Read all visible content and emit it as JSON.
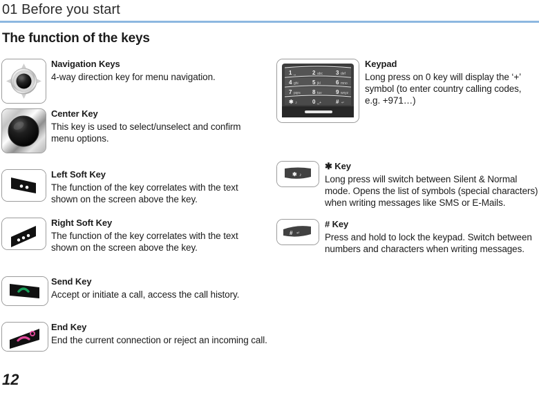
{
  "header": {
    "chapter": "01 Before you start",
    "section": "The function of the keys",
    "rule_color": "#8cb7e0"
  },
  "page_number": "12",
  "left_column": [
    {
      "icon": "navigation-keys-icon",
      "title": "Navigation Keys",
      "desc": "4-way direction key for menu navigation."
    },
    {
      "icon": "center-key-icon",
      "title": "Center Key",
      "desc": "This key is used to select/unselect and confirm menu options."
    },
    {
      "icon": "left-soft-key-icon",
      "title": "Left Soft Key",
      "desc": "The function of the key correlates with the text shown on the screen above the key."
    },
    {
      "icon": "right-soft-key-icon",
      "title": "Right Soft Key",
      "desc": "The function of the key correlates with the text shown on the screen above the key."
    },
    {
      "icon": "send-key-icon",
      "title": "Send Key",
      "desc": "Accept or initiate a call, access the call history."
    },
    {
      "icon": "end-key-icon",
      "title": "End Key",
      "desc": "End the current connection or reject an incoming call."
    }
  ],
  "right_column": [
    {
      "icon": "keypad-icon",
      "title": "Keypad",
      "desc": "Long press on 0 key will display the ‘+’ symbol (to enter country calling codes, e.g. +971…)"
    },
    {
      "icon": "star-key-icon",
      "title": "✱ Key",
      "desc": "Long press will switch between Silent & Normal mode. Opens the list of symbols (special characters) when writing messages like SMS or E-Mails."
    },
    {
      "icon": "hash-key-icon",
      "title": "# Key",
      "desc": "Press and hold to lock the keypad. Switch between numbers and characters when writing messages."
    }
  ],
  "keypad_icon": {
    "rows": [
      [
        {
          "num": "1",
          "sub": "␣"
        },
        {
          "num": "2",
          "sub": "abc"
        },
        {
          "num": "3",
          "sub": "def"
        }
      ],
      [
        {
          "num": "4",
          "sub": "ghi"
        },
        {
          "num": "5",
          "sub": "jkl"
        },
        {
          "num": "6",
          "sub": "mno"
        }
      ],
      [
        {
          "num": "7",
          "sub": "pqrs"
        },
        {
          "num": "8",
          "sub": "tuv"
        },
        {
          "num": "9",
          "sub": "wxyz"
        }
      ],
      [
        {
          "num": "✱",
          "sub": "♪"
        },
        {
          "num": "0",
          "sub": "␣+"
        },
        {
          "num": "#",
          "sub": "↵"
        }
      ]
    ]
  },
  "colors": {
    "send_key_handset": "#17a05a",
    "end_key_handset": "#e0489a",
    "key_body": "#111111",
    "keypad_body": "#3a3a3a",
    "icon_border": "#9b9b9b"
  }
}
